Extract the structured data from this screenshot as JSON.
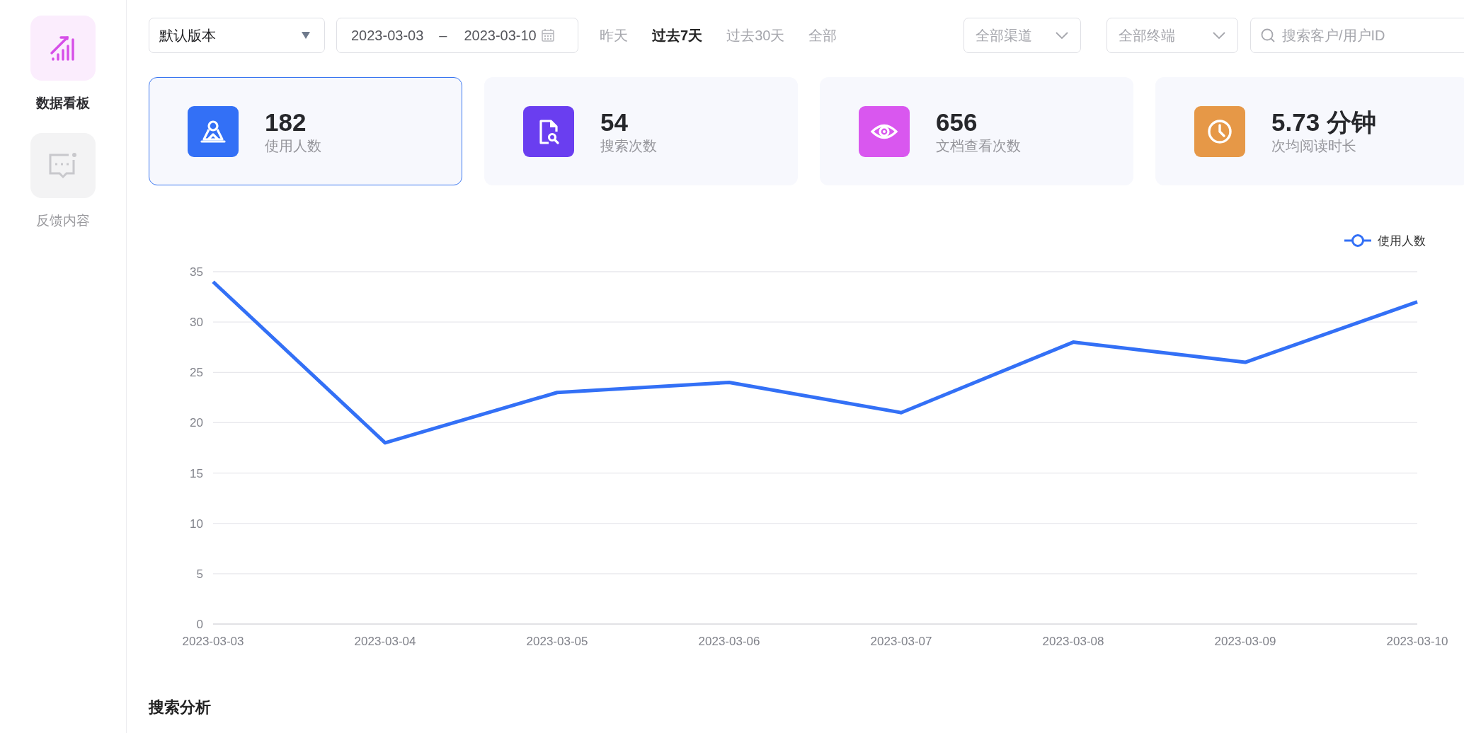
{
  "sidebar": {
    "items": [
      {
        "label": "数据看板",
        "kind": "chart",
        "selected": true
      },
      {
        "label": "反馈内容",
        "kind": "message",
        "selected": false
      }
    ]
  },
  "filters": {
    "version": {
      "value": "默认版本"
    },
    "date_range": {
      "start": "2023-03-03",
      "separator": "–",
      "end": "2023-03-10"
    },
    "quick_ranges": [
      {
        "label": "昨天",
        "selected": false
      },
      {
        "label": "过去7天",
        "selected": true
      },
      {
        "label": "过去30天",
        "selected": false
      },
      {
        "label": "全部",
        "selected": false
      }
    ],
    "channel": {
      "value": "全部渠道"
    },
    "terminal": {
      "value": "全部终端"
    },
    "search": {
      "placeholder": "搜索客户/用户ID"
    }
  },
  "stats": [
    {
      "value": "182",
      "label": "使用人数",
      "kind": "user",
      "color": "#3370f6",
      "selected": true
    },
    {
      "value": "54",
      "label": "搜索次数",
      "kind": "doc-search",
      "color": "#6a3ef0",
      "selected": false
    },
    {
      "value": "656",
      "label": "文档查看次数",
      "kind": "view",
      "color": "#d957ef",
      "selected": false
    },
    {
      "value": "5.73 分钟",
      "label": "次均阅读时长",
      "kind": "time",
      "color": "#e69847",
      "selected": false
    }
  ],
  "chart": {
    "chart_data": {
      "type": "line",
      "categories": [
        "2023-03-03",
        "2023-03-04",
        "2023-03-05",
        "2023-03-06",
        "2023-03-07",
        "2023-03-08",
        "2023-03-09",
        "2023-03-10"
      ],
      "series": [
        {
          "name": "使用人数",
          "color": "#3370f6",
          "values": [
            34,
            18,
            23,
            24,
            21,
            28,
            26,
            32
          ]
        }
      ],
      "ylim": [
        0,
        35
      ],
      "yticks": [
        0,
        5,
        10,
        15,
        20,
        25,
        30,
        35
      ],
      "grid": true
    }
  },
  "section_title": "搜索分析"
}
